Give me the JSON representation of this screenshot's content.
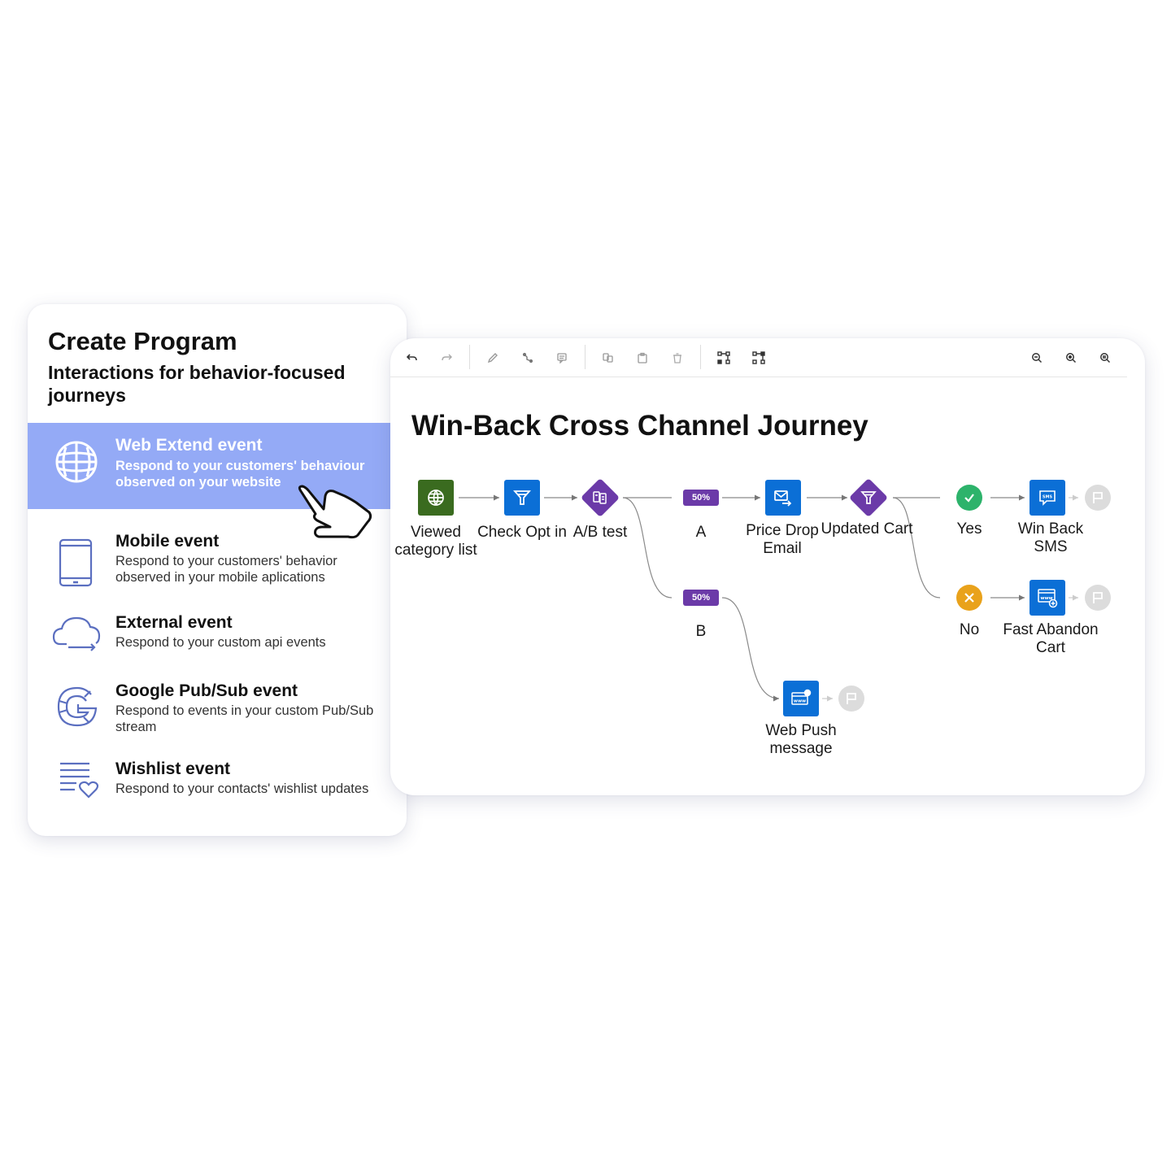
{
  "left_panel": {
    "title": "Create Program",
    "subtitle": "Interactions for behavior-focused journeys",
    "events": [
      {
        "icon": "globe-icon",
        "title": "Web Extend event",
        "description": "Respond to your customers' behaviour observed on your website",
        "selected": true
      },
      {
        "icon": "tablet-icon",
        "title": "Mobile event",
        "description": "Respond to your customers' behavior observed in your mobile aplications",
        "selected": false
      },
      {
        "icon": "cloud-sync-icon",
        "title": "External event",
        "description": "Respond to your custom api events",
        "selected": false
      },
      {
        "icon": "google-icon",
        "title": "Google Pub/Sub event",
        "description": "Respond to events in your custom Pub/Sub stream",
        "selected": false
      },
      {
        "icon": "wishlist-icon",
        "title": "Wishlist event",
        "description": "Respond to your contacts' wishlist updates",
        "selected": false
      }
    ],
    "cursor": "pointing-hand-cursor-icon"
  },
  "toolbar": {
    "buttons": [
      "undo-icon",
      "redo-icon",
      "edit-icon",
      "connector-icon",
      "comment-icon",
      "copy-icon",
      "paste-icon",
      "delete-icon",
      "auto-layout-icon",
      "tree-layout-icon",
      "zoom-out-icon",
      "zoom-reset-icon",
      "zoom-in-icon"
    ]
  },
  "journey": {
    "title": "Win-Back Cross Channel Journey",
    "colors": {
      "event_green": "#3a6b1f",
      "action_blue": "#0b6fd6",
      "decision_purple": "#6b3aa8",
      "yes_green": "#2db36b",
      "no_orange": "#e9a21b",
      "end_gray": "#dcdcdc",
      "link_gray": "#8a8a8a"
    },
    "nodes": {
      "viewed": {
        "label": "Viewed category list",
        "type": "event",
        "icon": "globe-icon"
      },
      "check": {
        "label": "Check Opt in",
        "type": "filter",
        "icon": "funnel-icon"
      },
      "ab": {
        "label": "A/B test",
        "type": "split",
        "icon": "ab-test-icon"
      },
      "a": {
        "label": "A",
        "badge": "50%"
      },
      "b": {
        "label": "B",
        "badge": "50%"
      },
      "price": {
        "label": "Price Drop Email",
        "type": "email",
        "icon": "email-send-icon"
      },
      "updated": {
        "label": "Updated Cart",
        "type": "decision",
        "icon": "funnel-icon"
      },
      "yes": {
        "label": "Yes",
        "icon": "check-icon"
      },
      "no": {
        "label": "No",
        "icon": "x-icon"
      },
      "sms": {
        "label": "Win Back SMS",
        "type": "sms",
        "icon": "sms-icon"
      },
      "fast": {
        "label": "Fast Abandon Cart",
        "type": "web",
        "icon": "web-add-icon"
      },
      "push": {
        "label": "Web Push message",
        "type": "web-push",
        "icon": "web-push-icon"
      }
    }
  }
}
